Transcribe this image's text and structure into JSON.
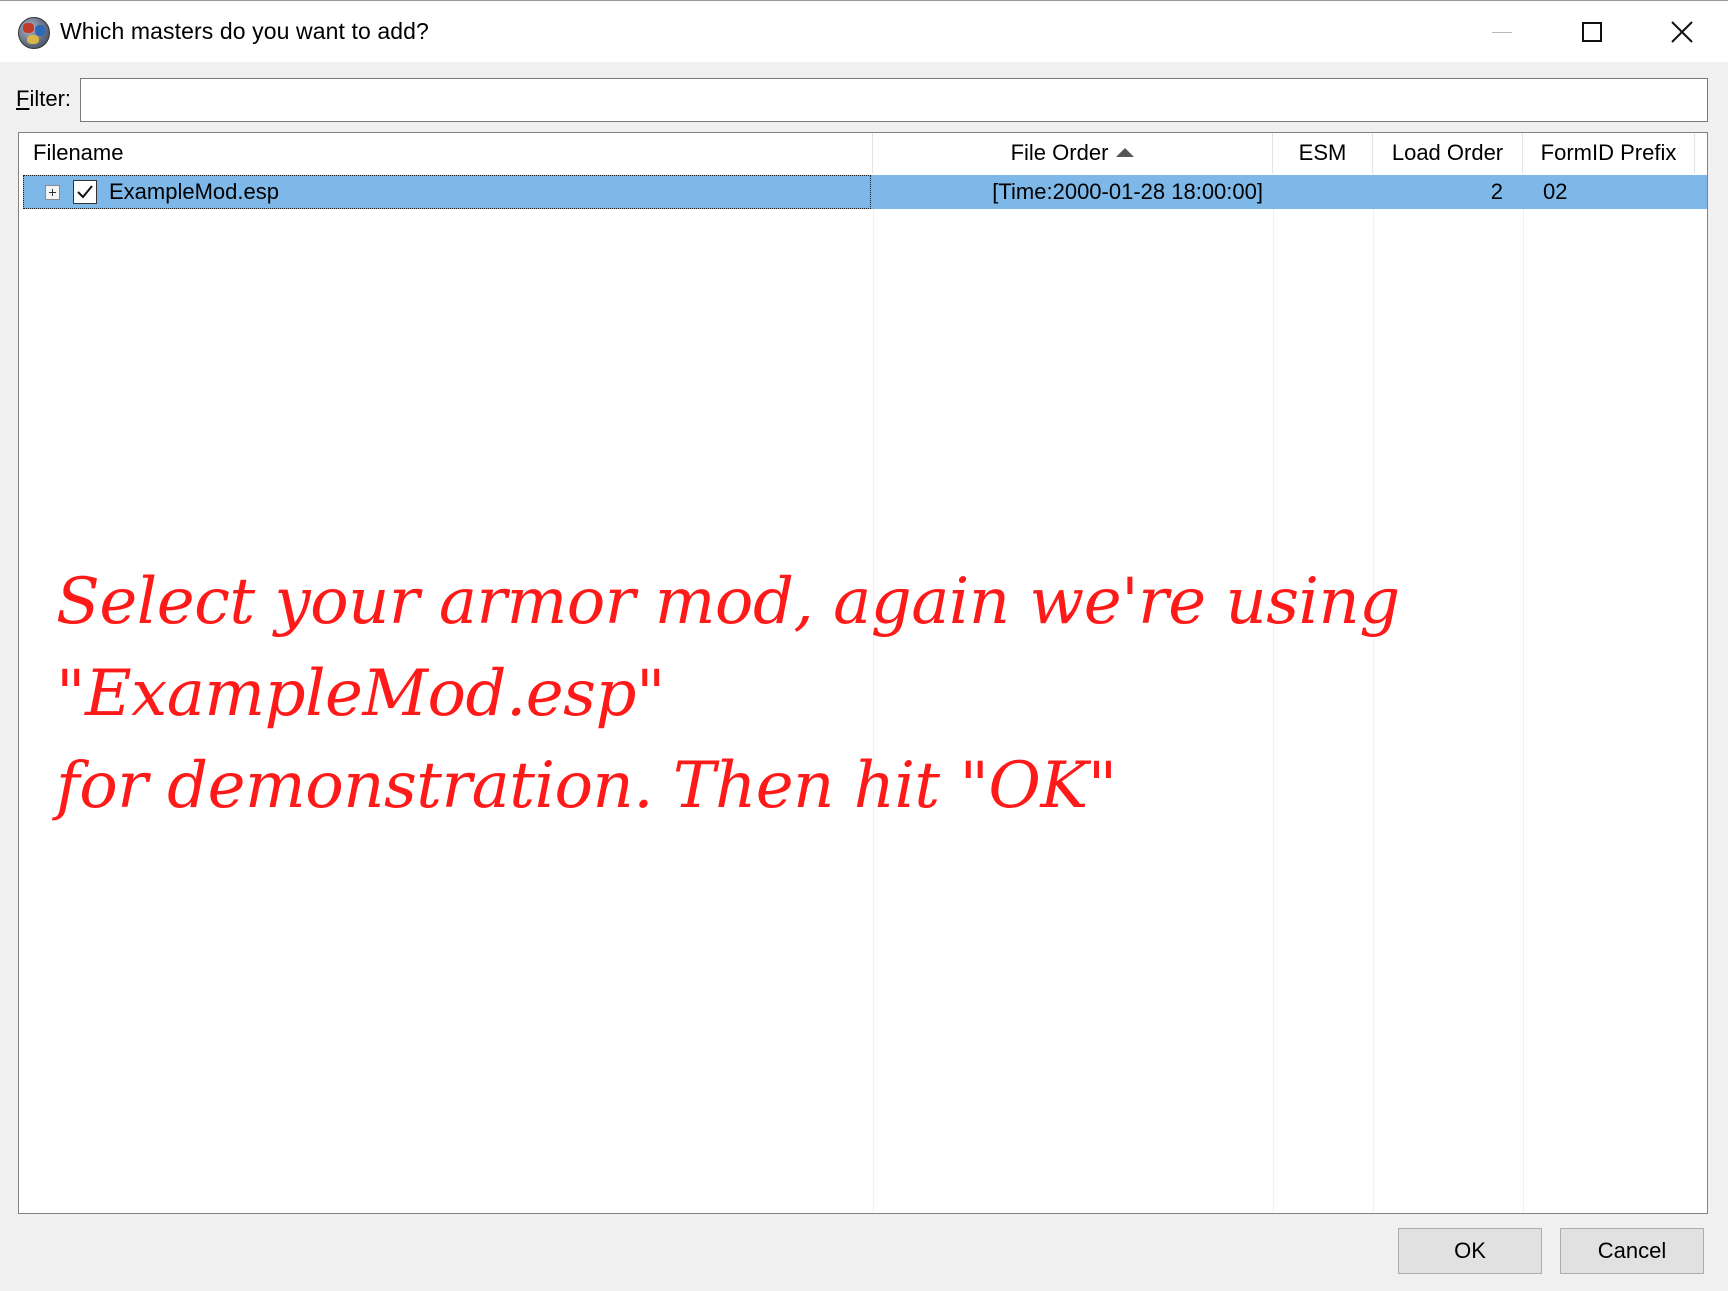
{
  "window": {
    "title": "Which masters do you want to add?",
    "icon": "app-globe-icon"
  },
  "filter": {
    "label_underlined": "F",
    "label_rest": "ilter:",
    "value": ""
  },
  "table": {
    "columns": [
      "Filename",
      "File Order",
      "ESM",
      "Load Order",
      "FormID Prefix"
    ],
    "sort_column": "File Order",
    "sort_direction": "ascending",
    "rows": [
      {
        "filename": "ExampleMod.esp",
        "checked": true,
        "expandable": true,
        "selected": true,
        "file_order": "[Time:2000-01-28 18:00:00]",
        "esm": "",
        "load_order": "2",
        "formid_prefix": "02"
      }
    ]
  },
  "annotation": {
    "line1": "Select your armor mod, again we're using \"ExampleMod.esp\"",
    "line2": "for demonstration. Then hit \"OK\"",
    "color": "#ff1a1a"
  },
  "buttons": {
    "ok": "OK",
    "cancel": "Cancel"
  },
  "colors": {
    "selection": "#7eb8e8",
    "title_bar": "#ffffff",
    "dialog_bg": "#f0f0f0"
  }
}
